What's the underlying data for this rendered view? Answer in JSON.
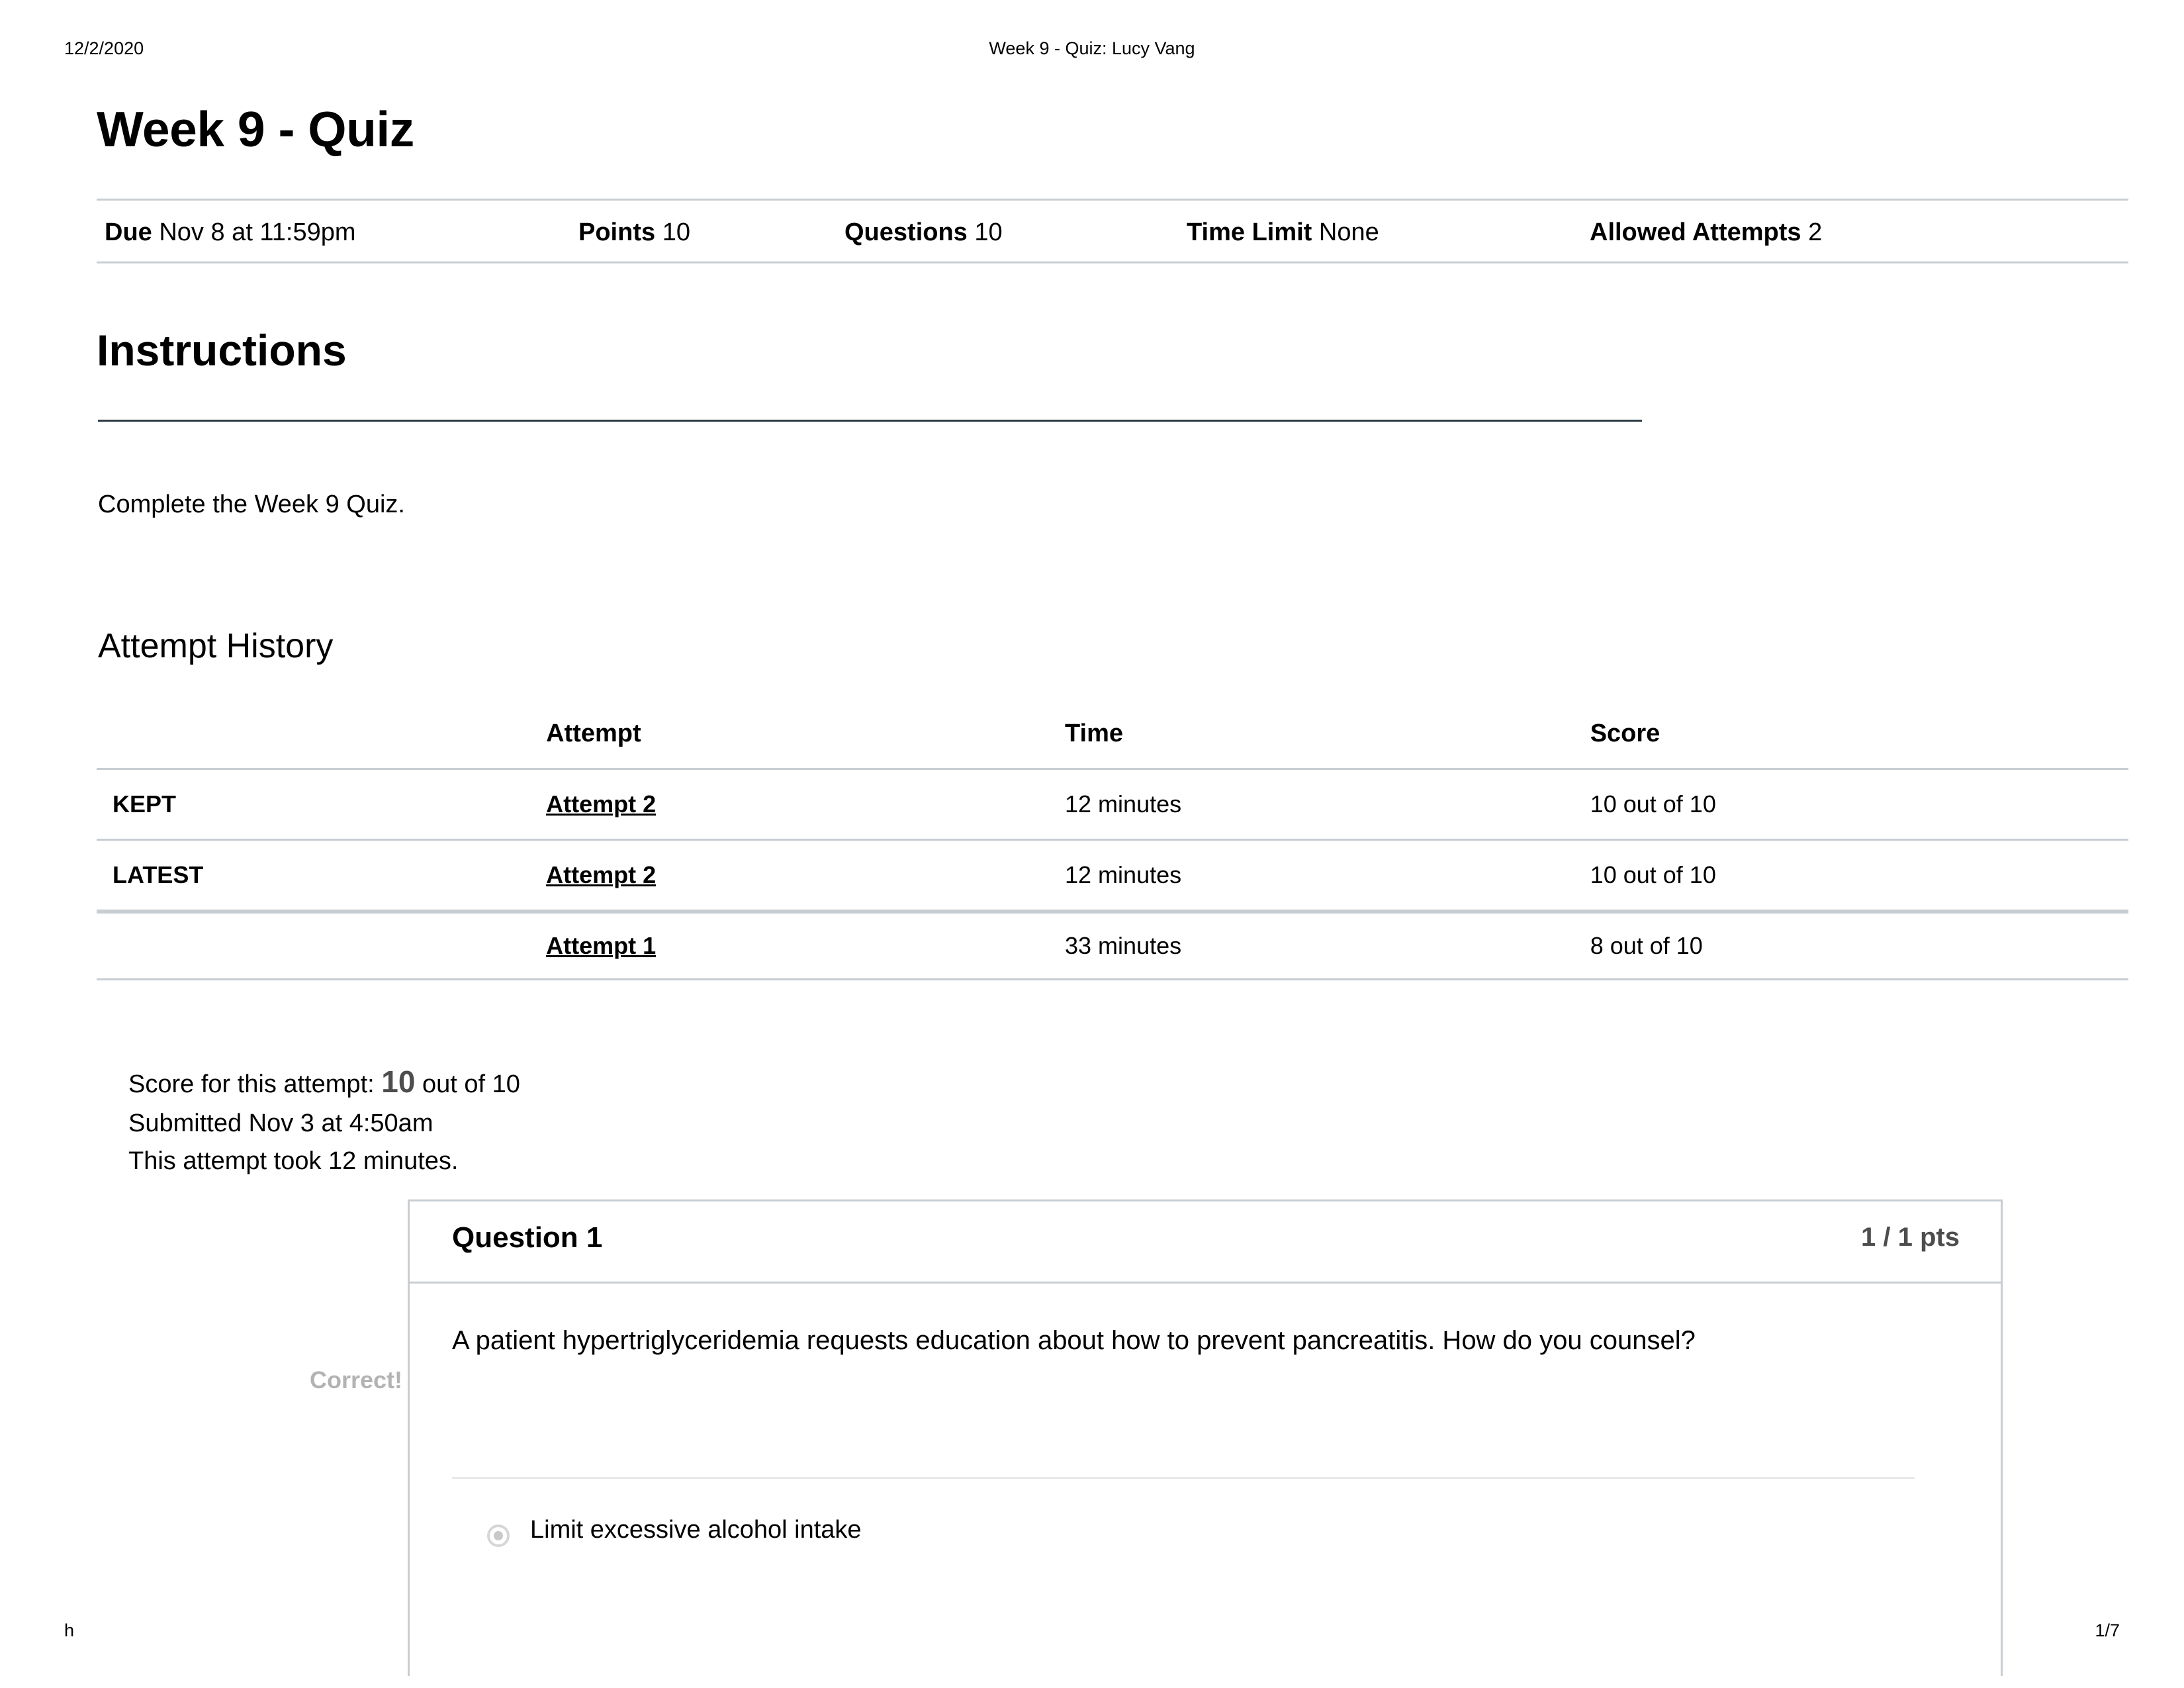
{
  "print": {
    "date": "12/2/2020",
    "doc_title": "Week 9 - Quiz: Lucy Vang",
    "footer_left": "h",
    "page_number": "1/7"
  },
  "quiz": {
    "title": "Week 9 - Quiz",
    "meta": {
      "due_label": "Due",
      "due_value": "Nov 8 at 11:59pm",
      "points_label": "Points",
      "points_value": "10",
      "questions_label": "Questions",
      "questions_value": "10",
      "time_limit_label": "Time Limit",
      "time_limit_value": "None",
      "allowed_attempts_label": "Allowed Attempts",
      "allowed_attempts_value": "2"
    }
  },
  "instructions": {
    "heading": "Instructions",
    "body": "Complete the Week 9 Quiz."
  },
  "attempt_history": {
    "heading": "Attempt History",
    "columns": [
      "",
      "Attempt",
      "Time",
      "Score"
    ],
    "rows": [
      {
        "status": "KEPT",
        "attempt": "Attempt 2 ",
        "time": "12 minutes",
        "score": "10 out of 10"
      },
      {
        "status": "LATEST",
        "attempt": "Attempt 2 ",
        "time": "12 minutes",
        "score": "10 out of 10"
      },
      {
        "status": "",
        "attempt": "Attempt 1 ",
        "time": "33 minutes",
        "score": "8 out of 10"
      }
    ]
  },
  "attempt_summary": {
    "score_prefix": "Score for this attempt: ",
    "score_value": "10",
    "score_suffix": " out of 10",
    "submitted": "Submitted Nov 3 at 4:50am",
    "duration": "This attempt took 12 minutes."
  },
  "question": {
    "title": "Question 1",
    "points": "1 / 1 pts",
    "text": "A patient hypertriglyceridemia requests education about how to prevent pancreatitis. How do you counsel?",
    "result_label": "Correct!",
    "answers": [
      {
        "label": "Limit excessive alcohol intake",
        "selected": true
      }
    ]
  },
  "colors": {
    "rule": "#c7cdd1",
    "heading_rule": "#2d3b45",
    "muted": "#4d4d4d",
    "correct_label": "#b3b3b3"
  }
}
